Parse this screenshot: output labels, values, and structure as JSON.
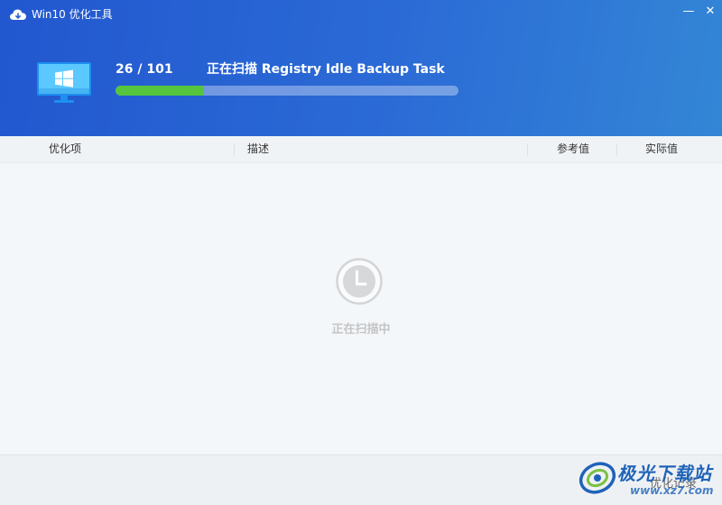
{
  "window": {
    "title": "Win10 优化工具",
    "minimize_label": "—",
    "close_label": "✕"
  },
  "scan": {
    "count": "26 / 101",
    "current": 26,
    "total": 101,
    "status": "正在扫描 Registry Idle Backup Task",
    "progress_fraction": 0.2574
  },
  "table": {
    "columns": [
      "优化项",
      "描述",
      "参考值",
      "实际值"
    ]
  },
  "content": {
    "icon": "clock-icon",
    "scanning_text": "正在扫描中"
  },
  "footer": {
    "record_label": "优化记录"
  },
  "watermark": {
    "name": "极光下载站",
    "url": "www.xz7.com"
  },
  "colors": {
    "header_start": "#2257cf",
    "header_end": "#3386d6",
    "progress_fill": "#55c53d",
    "monitor_screen": "#5bc8ff"
  }
}
